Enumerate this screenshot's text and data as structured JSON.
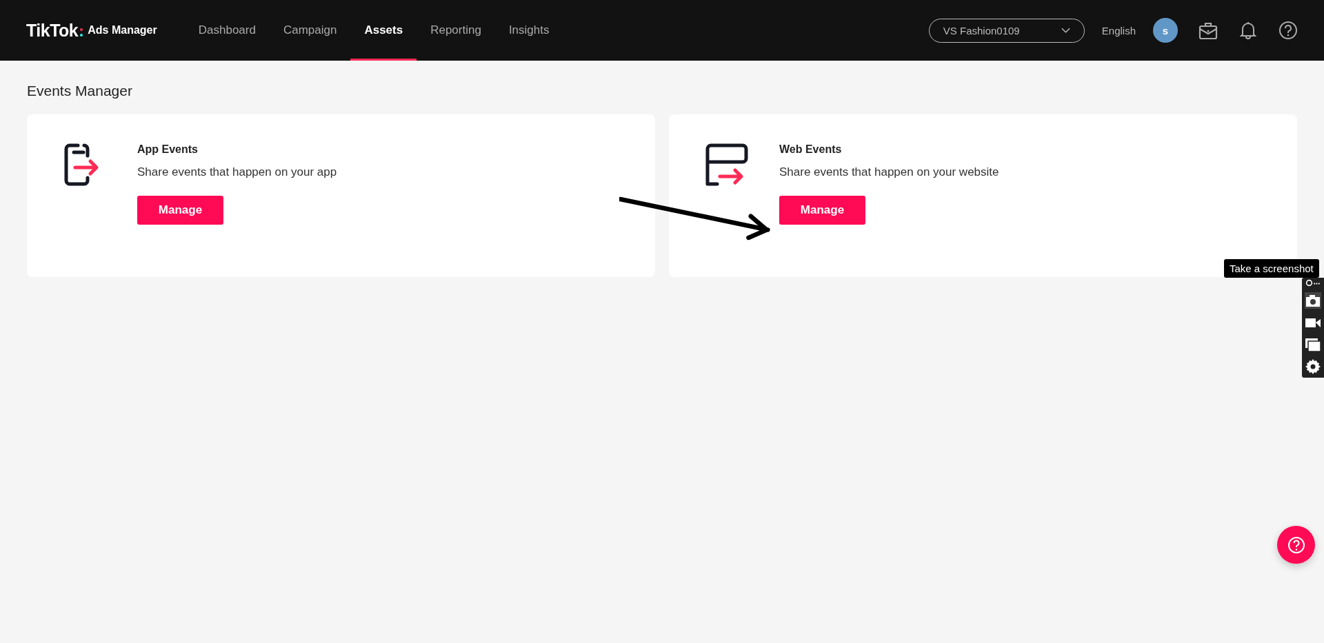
{
  "header": {
    "logo": "TikTok",
    "product": "Ads Manager",
    "nav": [
      {
        "label": "Dashboard",
        "selected": false
      },
      {
        "label": "Campaign",
        "selected": false
      },
      {
        "label": "Assets",
        "selected": true
      },
      {
        "label": "Reporting",
        "selected": false
      },
      {
        "label": "Insights",
        "selected": false
      }
    ],
    "account": "VS Fashion0109",
    "language": "English",
    "avatar": "s"
  },
  "page_title": "Events Manager",
  "cards": [
    {
      "kind": "app",
      "title": "App Events",
      "description": "Share events that happen on your app",
      "button": "Manage"
    },
    {
      "kind": "web",
      "title": "Web Events",
      "description": "Share events that happen on your website",
      "button": "Manage"
    }
  ],
  "screenshot_tool": {
    "tooltip": "Take a screenshot"
  }
}
